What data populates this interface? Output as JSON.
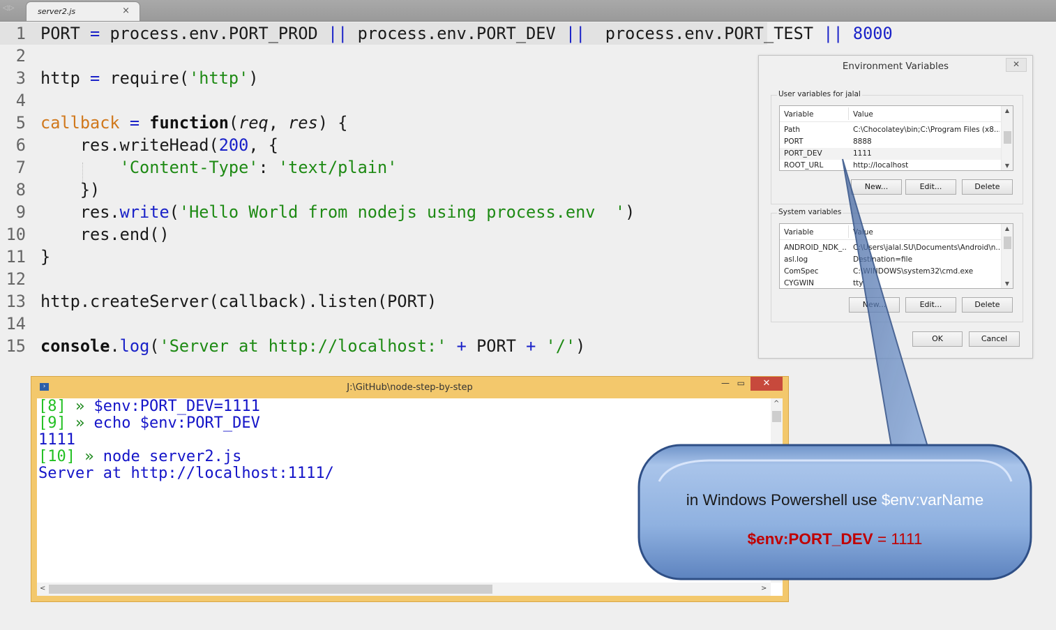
{
  "editor": {
    "tab_title": "server2.js",
    "tab_close": "×",
    "nav_arrows": "◁ ▷",
    "lines": [
      {
        "n": "1",
        "segs": [
          [
            "",
            "PORT "
          ],
          [
            "op",
            "="
          ],
          [
            "",
            " process.env.PORT_PROD "
          ],
          [
            "op",
            "||"
          ],
          [
            "",
            " process.env.PORT_DEV "
          ],
          [
            "op",
            "||"
          ],
          [
            "",
            "  process.env.PORT_TEST "
          ],
          [
            "op",
            "||"
          ],
          [
            "",
            ""
          ],
          [
            "num",
            " 8000"
          ]
        ]
      },
      {
        "n": "2",
        "segs": []
      },
      {
        "n": "3",
        "segs": [
          [
            "",
            "http "
          ],
          [
            "op",
            "="
          ],
          [
            "",
            " require("
          ],
          [
            "str",
            "'http'"
          ],
          [
            "",
            ")"
          ]
        ]
      },
      {
        "n": "4",
        "segs": []
      },
      {
        "n": "5",
        "segs": [
          [
            "var-orange",
            "callback"
          ],
          [
            "",
            ""
          ],
          [
            "op",
            " ="
          ],
          [
            "",
            " "
          ],
          [
            "kw",
            "function"
          ],
          [
            "",
            "("
          ],
          [
            "param",
            "req"
          ],
          [
            "",
            ", "
          ],
          [
            "param",
            "res"
          ],
          [
            "",
            ") {"
          ]
        ]
      },
      {
        "n": "6",
        "segs": [
          [
            "",
            "    res.writeHead("
          ],
          [
            "num",
            "200"
          ],
          [
            "",
            ", {"
          ]
        ]
      },
      {
        "n": "7",
        "segs": [
          [
            "",
            "        "
          ],
          [
            "str",
            "'Content-Type'"
          ],
          [
            "",
            ": "
          ],
          [
            "str",
            "'text/plain'"
          ]
        ]
      },
      {
        "n": "8",
        "segs": [
          [
            "",
            "    })"
          ]
        ]
      },
      {
        "n": "9",
        "segs": [
          [
            "",
            "    res."
          ],
          [
            "fn",
            "write"
          ],
          [
            "",
            "("
          ],
          [
            "str",
            "'Hello World from nodejs using process.env  '"
          ],
          [
            "",
            ")"
          ]
        ]
      },
      {
        "n": "10",
        "segs": [
          [
            "",
            "    res.end()"
          ]
        ]
      },
      {
        "n": "11",
        "segs": [
          [
            "",
            "}"
          ]
        ]
      },
      {
        "n": "12",
        "segs": []
      },
      {
        "n": "13",
        "segs": [
          [
            "",
            "http.createServer(callback).listen(PORT)"
          ]
        ]
      },
      {
        "n": "14",
        "segs": []
      },
      {
        "n": "15",
        "segs": [
          [
            "kw",
            "console"
          ],
          [
            "",
            "."
          ],
          [
            "fn",
            "log"
          ],
          [
            "",
            "("
          ],
          [
            "str",
            "'Server at http://localhost:'"
          ],
          [
            "",
            " "
          ],
          [
            "op",
            "+"
          ],
          [
            "",
            " PORT "
          ],
          [
            "op",
            "+"
          ],
          [
            "",
            " "
          ],
          [
            "str",
            "'/'"
          ],
          [
            "",
            ")"
          ]
        ]
      }
    ]
  },
  "env_dialog": {
    "title": "Environment Variables",
    "close": "✕",
    "user_group": "User variables for jalal",
    "system_group": "System variables",
    "col_variable": "Variable",
    "col_value": "Value",
    "user_vars": [
      {
        "name": "Path",
        "value": "C:\\Chocolatey\\bin;C:\\Program Files (x8..."
      },
      {
        "name": "PORT",
        "value": "8888"
      },
      {
        "name": "PORT_DEV",
        "value": "1111"
      },
      {
        "name": "ROOT_URL",
        "value": "http://localhost"
      }
    ],
    "system_vars": [
      {
        "name": "ANDROID_NDK_...",
        "value": "C:\\Users\\jalal.SU\\Documents\\Android\\n..."
      },
      {
        "name": "asl.log",
        "value": "Destination=file"
      },
      {
        "name": "ComSpec",
        "value": "C:\\WINDOWS\\system32\\cmd.exe"
      },
      {
        "name": "CYGWIN",
        "value": "tty"
      }
    ],
    "btn_new": "New...",
    "btn_edit": "Edit...",
    "btn_delete": "Delete",
    "btn_ok": "OK",
    "btn_cancel": "Cancel",
    "scroll_up": "▲",
    "scroll_down": "▼"
  },
  "powershell": {
    "title": "J:\\GitHub\\node-step-by-step",
    "minimize": "—",
    "maximize": "▭",
    "close": "✕",
    "lines": [
      {
        "prompt": "[8]",
        "cmd": " $env:PORT_DEV=1111"
      },
      {
        "prompt": "[9]",
        "cmd": " echo $env:PORT_DEV"
      },
      {
        "prompt": "",
        "cmd": "1111"
      },
      {
        "prompt": "[10]",
        "cmd": " node server2.js"
      },
      {
        "prompt": "",
        "cmd": "Server at http://localhost:1111/"
      }
    ],
    "chevron": "»",
    "scroll_left": "<",
    "scroll_right": ">",
    "scroll_up": "^"
  },
  "callout": {
    "line1_prefix": "in Windows Powershell use ",
    "line1_accent": "$env:varName",
    "line2_var": "$env:PORT_DEV",
    "line2_rest": " = 1111"
  },
  "colors": {
    "code_operator": "#1a22c8",
    "code_string": "#1e8a14",
    "code_orange": "#d0781c",
    "ps_prompt": "#22c022",
    "ps_text": "#1414c8",
    "callout_fill": "#8aaede",
    "callout_accent": "#ffffff",
    "callout_red": "#c00000"
  }
}
